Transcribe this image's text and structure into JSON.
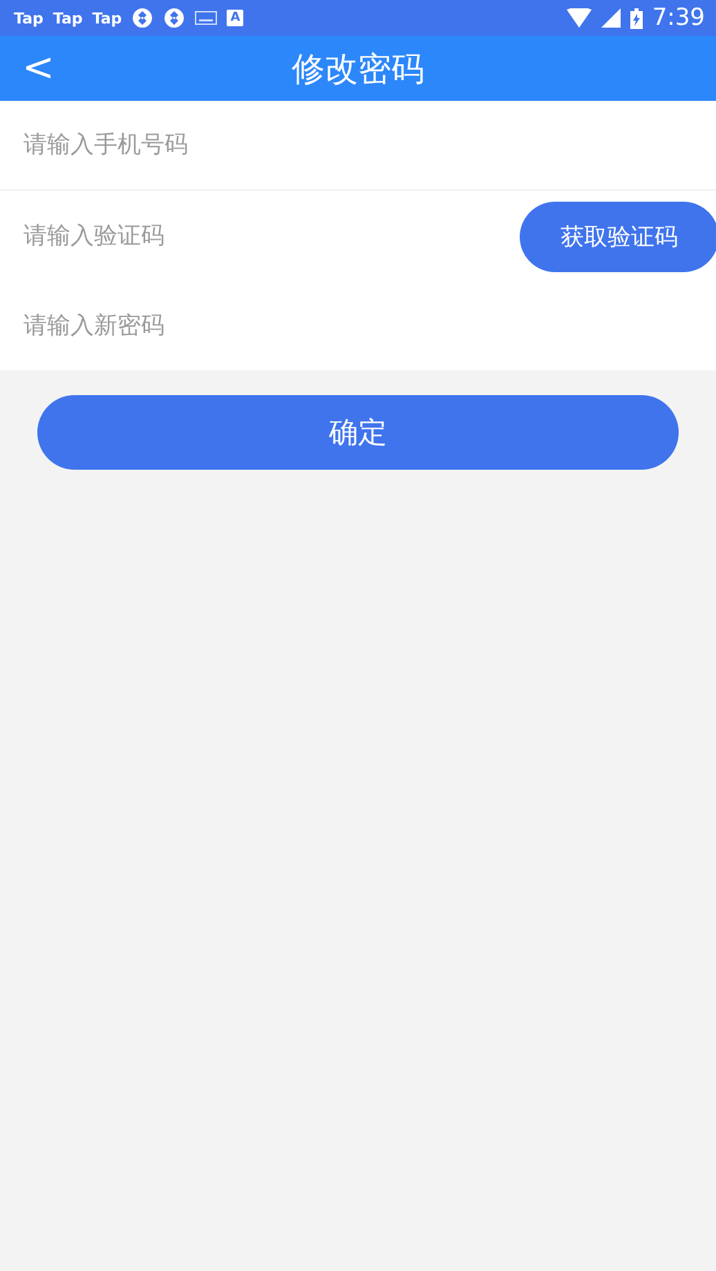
{
  "status_bar": {
    "notifications": [
      "Tap",
      "Tap",
      "Tap"
    ],
    "app_badge": "A",
    "time": "7:39"
  },
  "header": {
    "back": "<",
    "title": "修改密码"
  },
  "fields": [
    {
      "kind": "plain",
      "placeholder": "请输入手机号码"
    },
    {
      "kind": "code",
      "placeholder": "请输入验证码",
      "button": "获取验证码"
    },
    {
      "kind": "plain",
      "placeholder": "请输入新密码"
    }
  ],
  "submit": "确定"
}
